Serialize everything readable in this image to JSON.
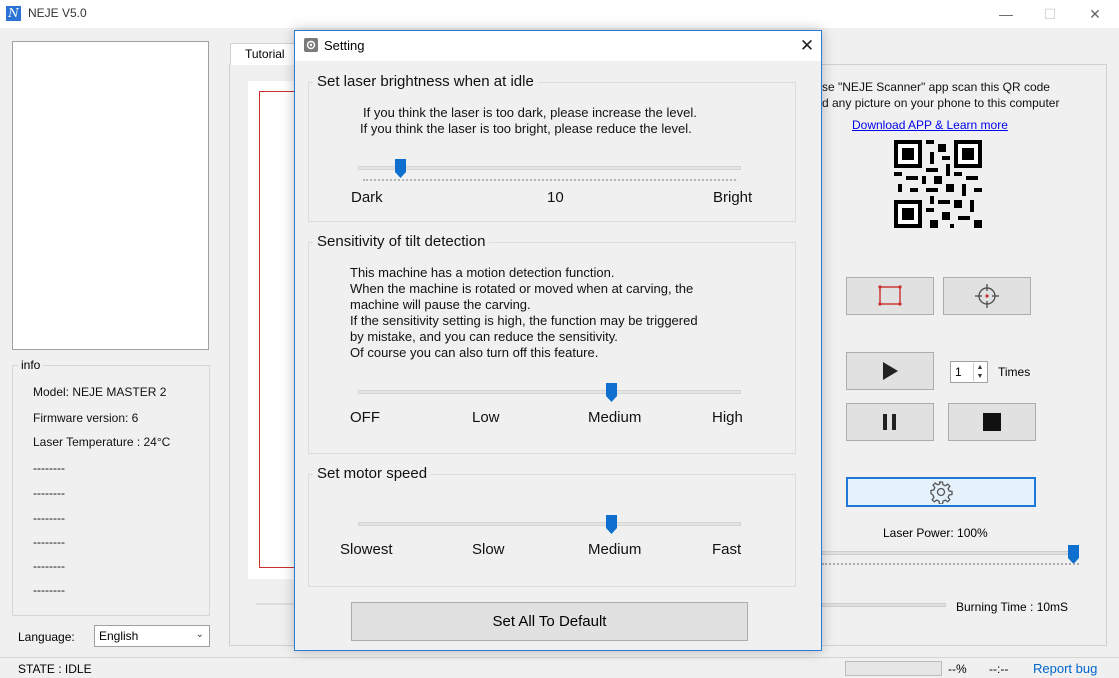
{
  "window": {
    "title": "NEJE V5.0",
    "icon_glyph": "N",
    "minimize": "—",
    "maximize": "☐",
    "close": "✕"
  },
  "info": {
    "label": "info",
    "lines": [
      "Model: NEJE MASTER 2",
      "Firmware version: 6",
      "Laser Temperature : 24°C",
      "--------",
      "--------",
      "--------",
      "--------",
      "--------",
      "--------"
    ]
  },
  "language": {
    "label": "Language:",
    "value": "English"
  },
  "tabs": {
    "tutorial": "Tutorial"
  },
  "scanner": {
    "line1": "se \"NEJE Scanner\" app scan this QR code",
    "line2": "d any picture on your phone to this computer",
    "link": "Download APP & Learn more"
  },
  "controls": {
    "times_value": "1",
    "times_label": "Times",
    "laser_power": "Laser Power: 100%",
    "laser_power_level": 1.0,
    "burning_time": "Burning Time : 10mS",
    "icons": [
      "frame-icon",
      "crosshair-icon",
      "play-icon",
      "pause-icon",
      "stop-icon",
      "gear-icon"
    ]
  },
  "status": {
    "state": "STATE : IDLE",
    "percent": "--%",
    "time": "--:--",
    "report": "Report bug"
  },
  "dialog": {
    "title": "Setting",
    "close": "✕",
    "brightness": {
      "title": "Set laser brightness when at idle",
      "desc1": "If you think the laser is too dark, please increase the level.",
      "desc2": "If you think the laser is too bright, please reduce the  level.",
      "min_label": "Dark",
      "value": "10",
      "max_label": "Bright",
      "level": 0.11
    },
    "tilt": {
      "title": "Sensitivity of tilt detection",
      "desc": [
        "This machine has a motion detection function.",
        "When the machine is rotated or moved when at carving, the",
        "machine will pause the carving.",
        "If the sensitivity setting is high, the function may be triggered",
        "by mistake, and you can reduce the sensitivity.",
        "Of course you can also turn off this feature."
      ],
      "options": [
        "OFF",
        "Low",
        "Medium",
        "High"
      ],
      "selected": "Medium"
    },
    "motor": {
      "title": "Set motor speed",
      "options": [
        "Slowest",
        "Slow",
        "Medium",
        "Fast"
      ],
      "selected": "Medium"
    },
    "default_button": "Set All To Default"
  },
  "colors": {
    "accent": "#0f6fcf",
    "link": "#0000ee",
    "report": "#0066cc",
    "frame_red": "#c9302c",
    "focus_border": "#1e78d7"
  }
}
